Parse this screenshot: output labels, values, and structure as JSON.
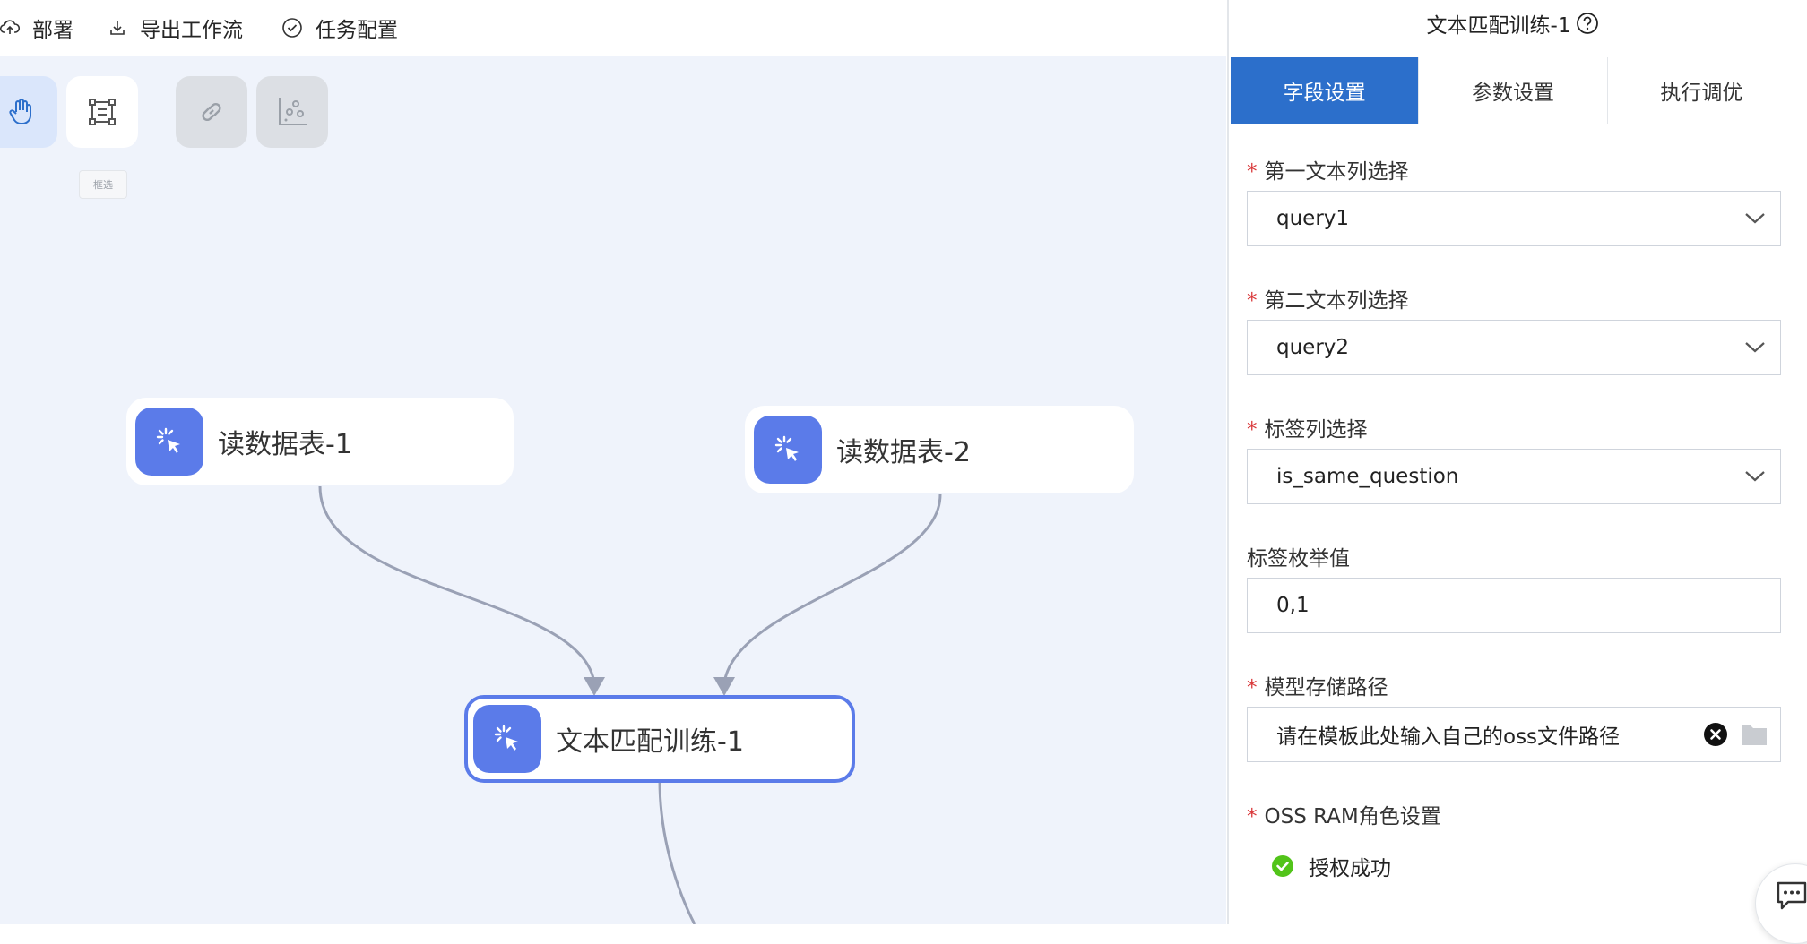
{
  "toolbar": {
    "deploy_label": "部署",
    "export_label": "导出工作流",
    "task_config_label": "任务配置"
  },
  "canvas": {
    "tools": {
      "pan_icon": "hand-icon",
      "marquee_icon": "marquee-select-icon",
      "link_icon": "link-icon",
      "scatter_icon": "scatter-plot-icon",
      "tooltip": "框选"
    },
    "nodes": [
      {
        "label": "读数据表-1",
        "icon": "cursor-click-icon"
      },
      {
        "label": "读数据表-2",
        "icon": "cursor-click-icon"
      },
      {
        "label": "文本匹配训练-1",
        "icon": "cursor-click-icon",
        "selected": true
      }
    ],
    "colors": {
      "node_icon_bg": "#5b7be9",
      "edge": "#9aa1b5",
      "canvas_bg": "#eff3fb"
    }
  },
  "panel": {
    "title": "文本匹配训练-1",
    "tabs": [
      {
        "label": "字段设置",
        "active": true
      },
      {
        "label": "参数设置"
      },
      {
        "label": "执行调优"
      }
    ],
    "fields": [
      {
        "label": "第一文本列选择",
        "required": true,
        "value": "query1",
        "type": "select"
      },
      {
        "label": "第二文本列选择",
        "required": true,
        "value": "query2",
        "type": "select"
      },
      {
        "label": "标签列选择",
        "required": true,
        "value": "is_same_question",
        "type": "select"
      },
      {
        "label": "标签枚举值",
        "required": false,
        "value": "0,1",
        "type": "input"
      },
      {
        "label": "模型存储路径",
        "required": true,
        "value": "请在模板此处输入自己的oss文件路径",
        "type": "path"
      },
      {
        "label": "OSS RAM角色设置",
        "required": true,
        "status": "授权成功"
      }
    ],
    "colors": {
      "active_tab": "#2c6fcb",
      "required": "#d9383a",
      "success": "#52c41a"
    }
  }
}
